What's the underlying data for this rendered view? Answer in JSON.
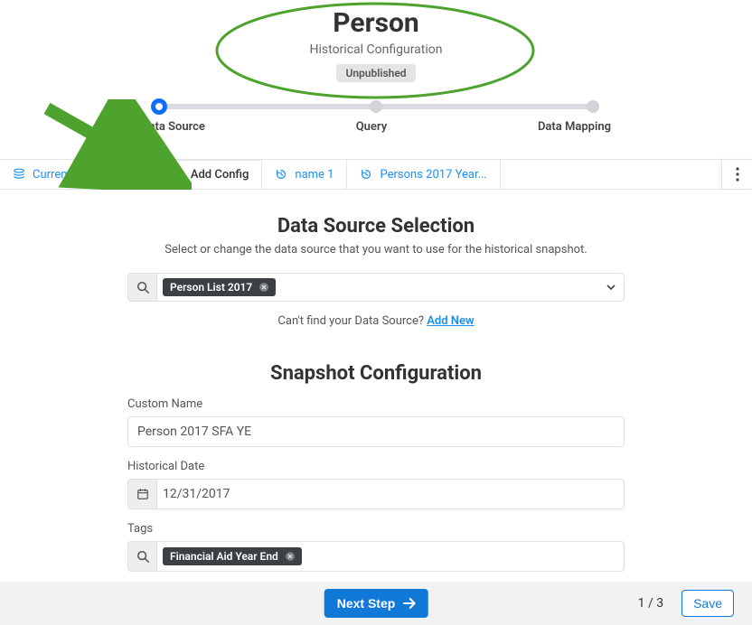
{
  "header": {
    "title": "Person",
    "subtitle": "Historical Configuration",
    "status_badge": "Unpublished"
  },
  "stepper": {
    "steps": [
      "Data Source",
      "Query",
      "Data Mapping"
    ],
    "active_index": 0
  },
  "tabs": {
    "items": [
      {
        "icon": "stack-icon",
        "label": "Current Configuration"
      },
      {
        "icon": "plus-icon",
        "label": "Add Config"
      },
      {
        "icon": "history-icon",
        "label": "name 1"
      },
      {
        "icon": "history-icon",
        "label": "Persons 2017 Year..."
      }
    ],
    "active_index": 1
  },
  "data_source": {
    "section_title": "Data Source Selection",
    "section_sub": "Select or change the data source that you want to use for the historical snapshot.",
    "selected_chip": "Person List 2017",
    "help_prefix": "Can't find your Data Source? ",
    "help_link": "Add New"
  },
  "snapshot": {
    "section_title": "Snapshot Configuration",
    "custom_name_label": "Custom Name",
    "custom_name_value": "Person 2017 SFA YE",
    "historical_date_label": "Historical Date",
    "historical_date_value": "12/31/2017",
    "tags_label": "Tags",
    "tag_chip": "Financial Aid Year End"
  },
  "footer": {
    "next_label": "Next Step",
    "page_indicator": "1 / 3",
    "save_label": "Save"
  }
}
